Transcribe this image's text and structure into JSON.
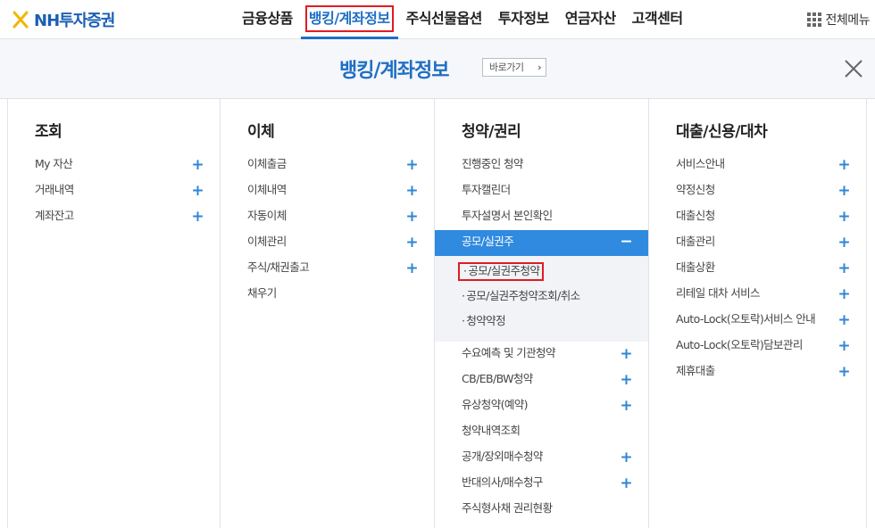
{
  "brand": {
    "logo_text": "NH투자증권"
  },
  "nav": {
    "items": [
      "금융상품",
      "뱅킹/계좌정보",
      "주식선물옵션",
      "투자정보",
      "연금자산",
      "고객센터"
    ],
    "all_menu": "전체메뉴"
  },
  "section": {
    "title": "뱅킹/계좌정보",
    "shortcut": "바로가기"
  },
  "columns": [
    {
      "title": "조회",
      "items": [
        {
          "label": "My 자산",
          "icon": "plus-icon"
        },
        {
          "label": "거래내역",
          "icon": "plus-icon"
        },
        {
          "label": "계좌잔고",
          "icon": "plus-icon"
        }
      ]
    },
    {
      "title": "이체",
      "items": [
        {
          "label": "이체출금",
          "icon": "plus-icon"
        },
        {
          "label": "이체내역",
          "icon": "plus-icon"
        },
        {
          "label": "자동이체",
          "icon": "plus-icon"
        },
        {
          "label": "이체관리",
          "icon": "plus-icon"
        },
        {
          "label": "주식/채권출고",
          "icon": "plus-icon"
        },
        {
          "label": "채우기"
        }
      ]
    },
    {
      "title": "청약/권리",
      "items_before": [
        "진행중인 청약",
        "투자캘린더",
        "투자설명서 본인확인"
      ],
      "open_item": "공모/실권주",
      "sub_items": [
        "공모/실권주청약",
        "공모/실권주청약조회/취소",
        "청약약정"
      ],
      "items_after": [
        {
          "label": "수요예측 및 기관청약",
          "icon": "plus-icon"
        },
        {
          "label": "CB/EB/BW청약",
          "icon": "plus-icon"
        },
        {
          "label": "유상청약(예약)",
          "icon": "plus-icon"
        },
        {
          "label": "청약내역조회"
        },
        {
          "label": "공개/장외매수청약",
          "icon": "plus-icon"
        },
        {
          "label": "반대의사/매수청구",
          "icon": "plus-icon"
        },
        {
          "label": "주식형사채 권리현황"
        }
      ]
    },
    {
      "title": "대출/신용/대차",
      "items": [
        {
          "label": "서비스안내",
          "icon": "plus-icon"
        },
        {
          "label": "약정신청",
          "icon": "plus-icon"
        },
        {
          "label": "대출신청",
          "icon": "plus-icon"
        },
        {
          "label": "대출관리",
          "icon": "plus-icon"
        },
        {
          "label": "대출상환",
          "icon": "plus-icon"
        },
        {
          "label": "리테일 대차 서비스",
          "icon": "plus-icon"
        },
        {
          "label": "Auto-Lock(오토락)서비스 안내",
          "icon": "plus-icon"
        },
        {
          "label": "Auto-Lock(오토락)담보관리",
          "icon": "plus-icon"
        },
        {
          "label": "제휴대출",
          "icon": "plus-icon"
        }
      ]
    }
  ],
  "colors": {
    "accent": "#1f6fc5",
    "open_bg": "#2f8ae0",
    "highlight": "#e01b24"
  }
}
